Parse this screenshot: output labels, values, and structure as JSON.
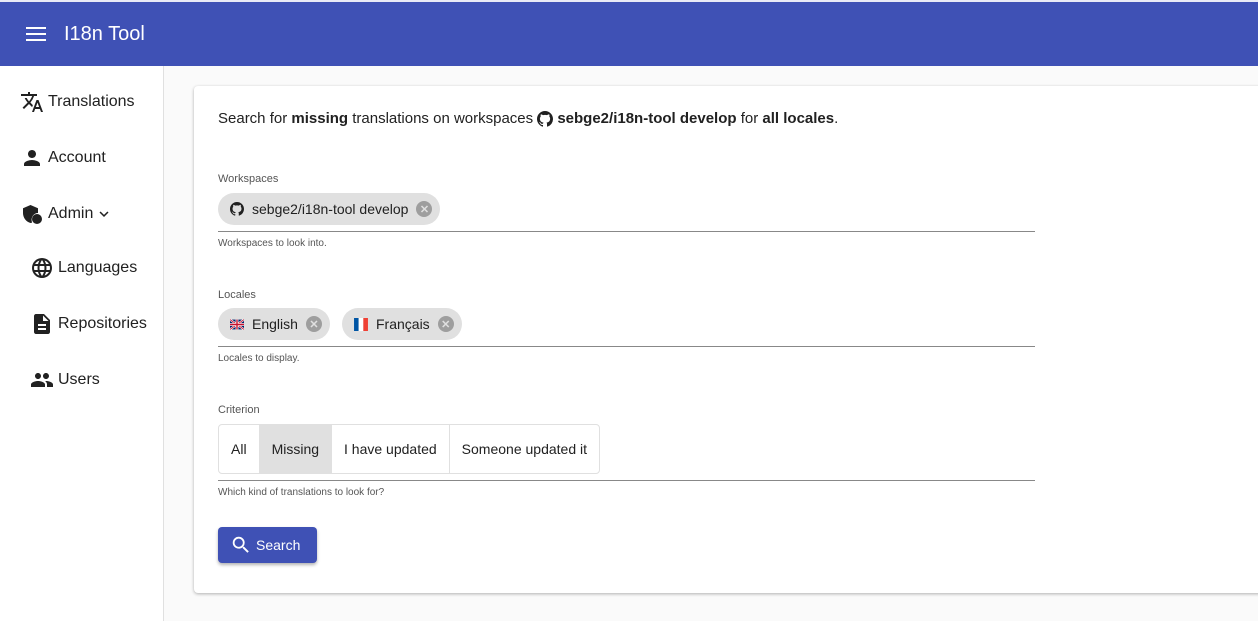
{
  "app": {
    "title": "I18n Tool",
    "primary_color": "#3f51b5"
  },
  "sidebar": {
    "items": [
      {
        "label": "Translations",
        "icon": "translate-icon"
      },
      {
        "label": "Account",
        "icon": "person-icon"
      },
      {
        "label": "Admin",
        "icon": "admin-shield-icon",
        "expanded": true
      },
      {
        "label": "Languages",
        "icon": "globe-icon"
      },
      {
        "label": "Repositories",
        "icon": "document-icon"
      },
      {
        "label": "Users",
        "icon": "group-icon"
      }
    ]
  },
  "summary": {
    "p1": "Search for ",
    "criterion": "missing",
    "p2": " translations on workspaces ",
    "workspace": "sebge2/i18n-tool develop",
    "p3": " for ",
    "locales": "all locales",
    "p4": "."
  },
  "workspaces": {
    "label": "Workspaces",
    "hint": "Workspaces to look into.",
    "chips": [
      {
        "label": "sebge2/i18n-tool develop",
        "icon": "github-icon"
      }
    ]
  },
  "locales": {
    "label": "Locales",
    "hint": "Locales to display.",
    "chips": [
      {
        "label": "English",
        "icon": "uk-flag-icon"
      },
      {
        "label": "Français",
        "icon": "france-flag-icon"
      }
    ]
  },
  "criterion": {
    "label": "Criterion",
    "hint": "Which kind of translations to look for?",
    "options": [
      "All",
      "Missing",
      "I have updated",
      "Someone updated it"
    ],
    "selected": "Missing"
  },
  "search_button": "Search"
}
